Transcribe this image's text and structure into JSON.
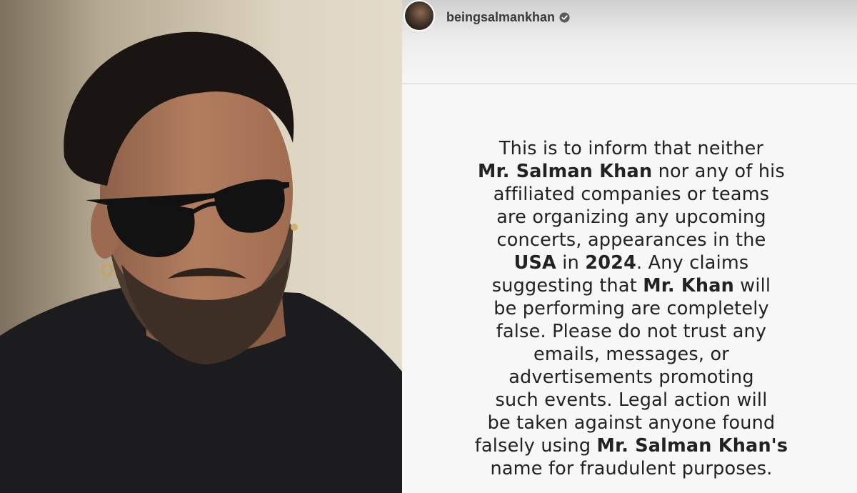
{
  "story": {
    "username": "beingsalmankhan",
    "verified_icon": "verified-badge-icon",
    "notice_lines": [
      [
        {
          "t": "This is to inform that neither",
          "b": false
        }
      ],
      [
        {
          "t": "Mr. Salman Khan",
          "b": true
        },
        {
          "t": " nor any of his",
          "b": false
        }
      ],
      [
        {
          "t": "affiliated companies or teams",
          "b": false
        }
      ],
      [
        {
          "t": "are organizing any upcoming",
          "b": false
        }
      ],
      [
        {
          "t": "concerts, appearances in the",
          "b": false
        }
      ],
      [
        {
          "t": "USA",
          "b": true
        },
        {
          "t": " in ",
          "b": false
        },
        {
          "t": "2024",
          "b": true
        },
        {
          "t": ". Any claims",
          "b": false
        }
      ],
      [
        {
          "t": "suggesting that ",
          "b": false
        },
        {
          "t": "Mr. Khan",
          "b": true
        },
        {
          "t": " will",
          "b": false
        }
      ],
      [
        {
          "t": "be performing are completely",
          "b": false
        }
      ],
      [
        {
          "t": "false. Please do not trust any",
          "b": false
        }
      ],
      [
        {
          "t": "emails, messages, or",
          "b": false
        }
      ],
      [
        {
          "t": "advertisements promoting",
          "b": false
        }
      ],
      [
        {
          "t": "such events. Legal action will",
          "b": false
        }
      ],
      [
        {
          "t": "be taken against anyone found",
          "b": false
        }
      ],
      [
        {
          "t": "falsely using ",
          "b": false
        },
        {
          "t": "Mr. Salman Khan's",
          "b": true
        }
      ],
      [
        {
          "t": "name for fraudulent purposes.",
          "b": false
        }
      ]
    ]
  },
  "colors": {
    "story_background": "#f7f7f7",
    "text": "#222222",
    "shirt": "#1c1c1e",
    "wall": "#d8cfbc"
  }
}
